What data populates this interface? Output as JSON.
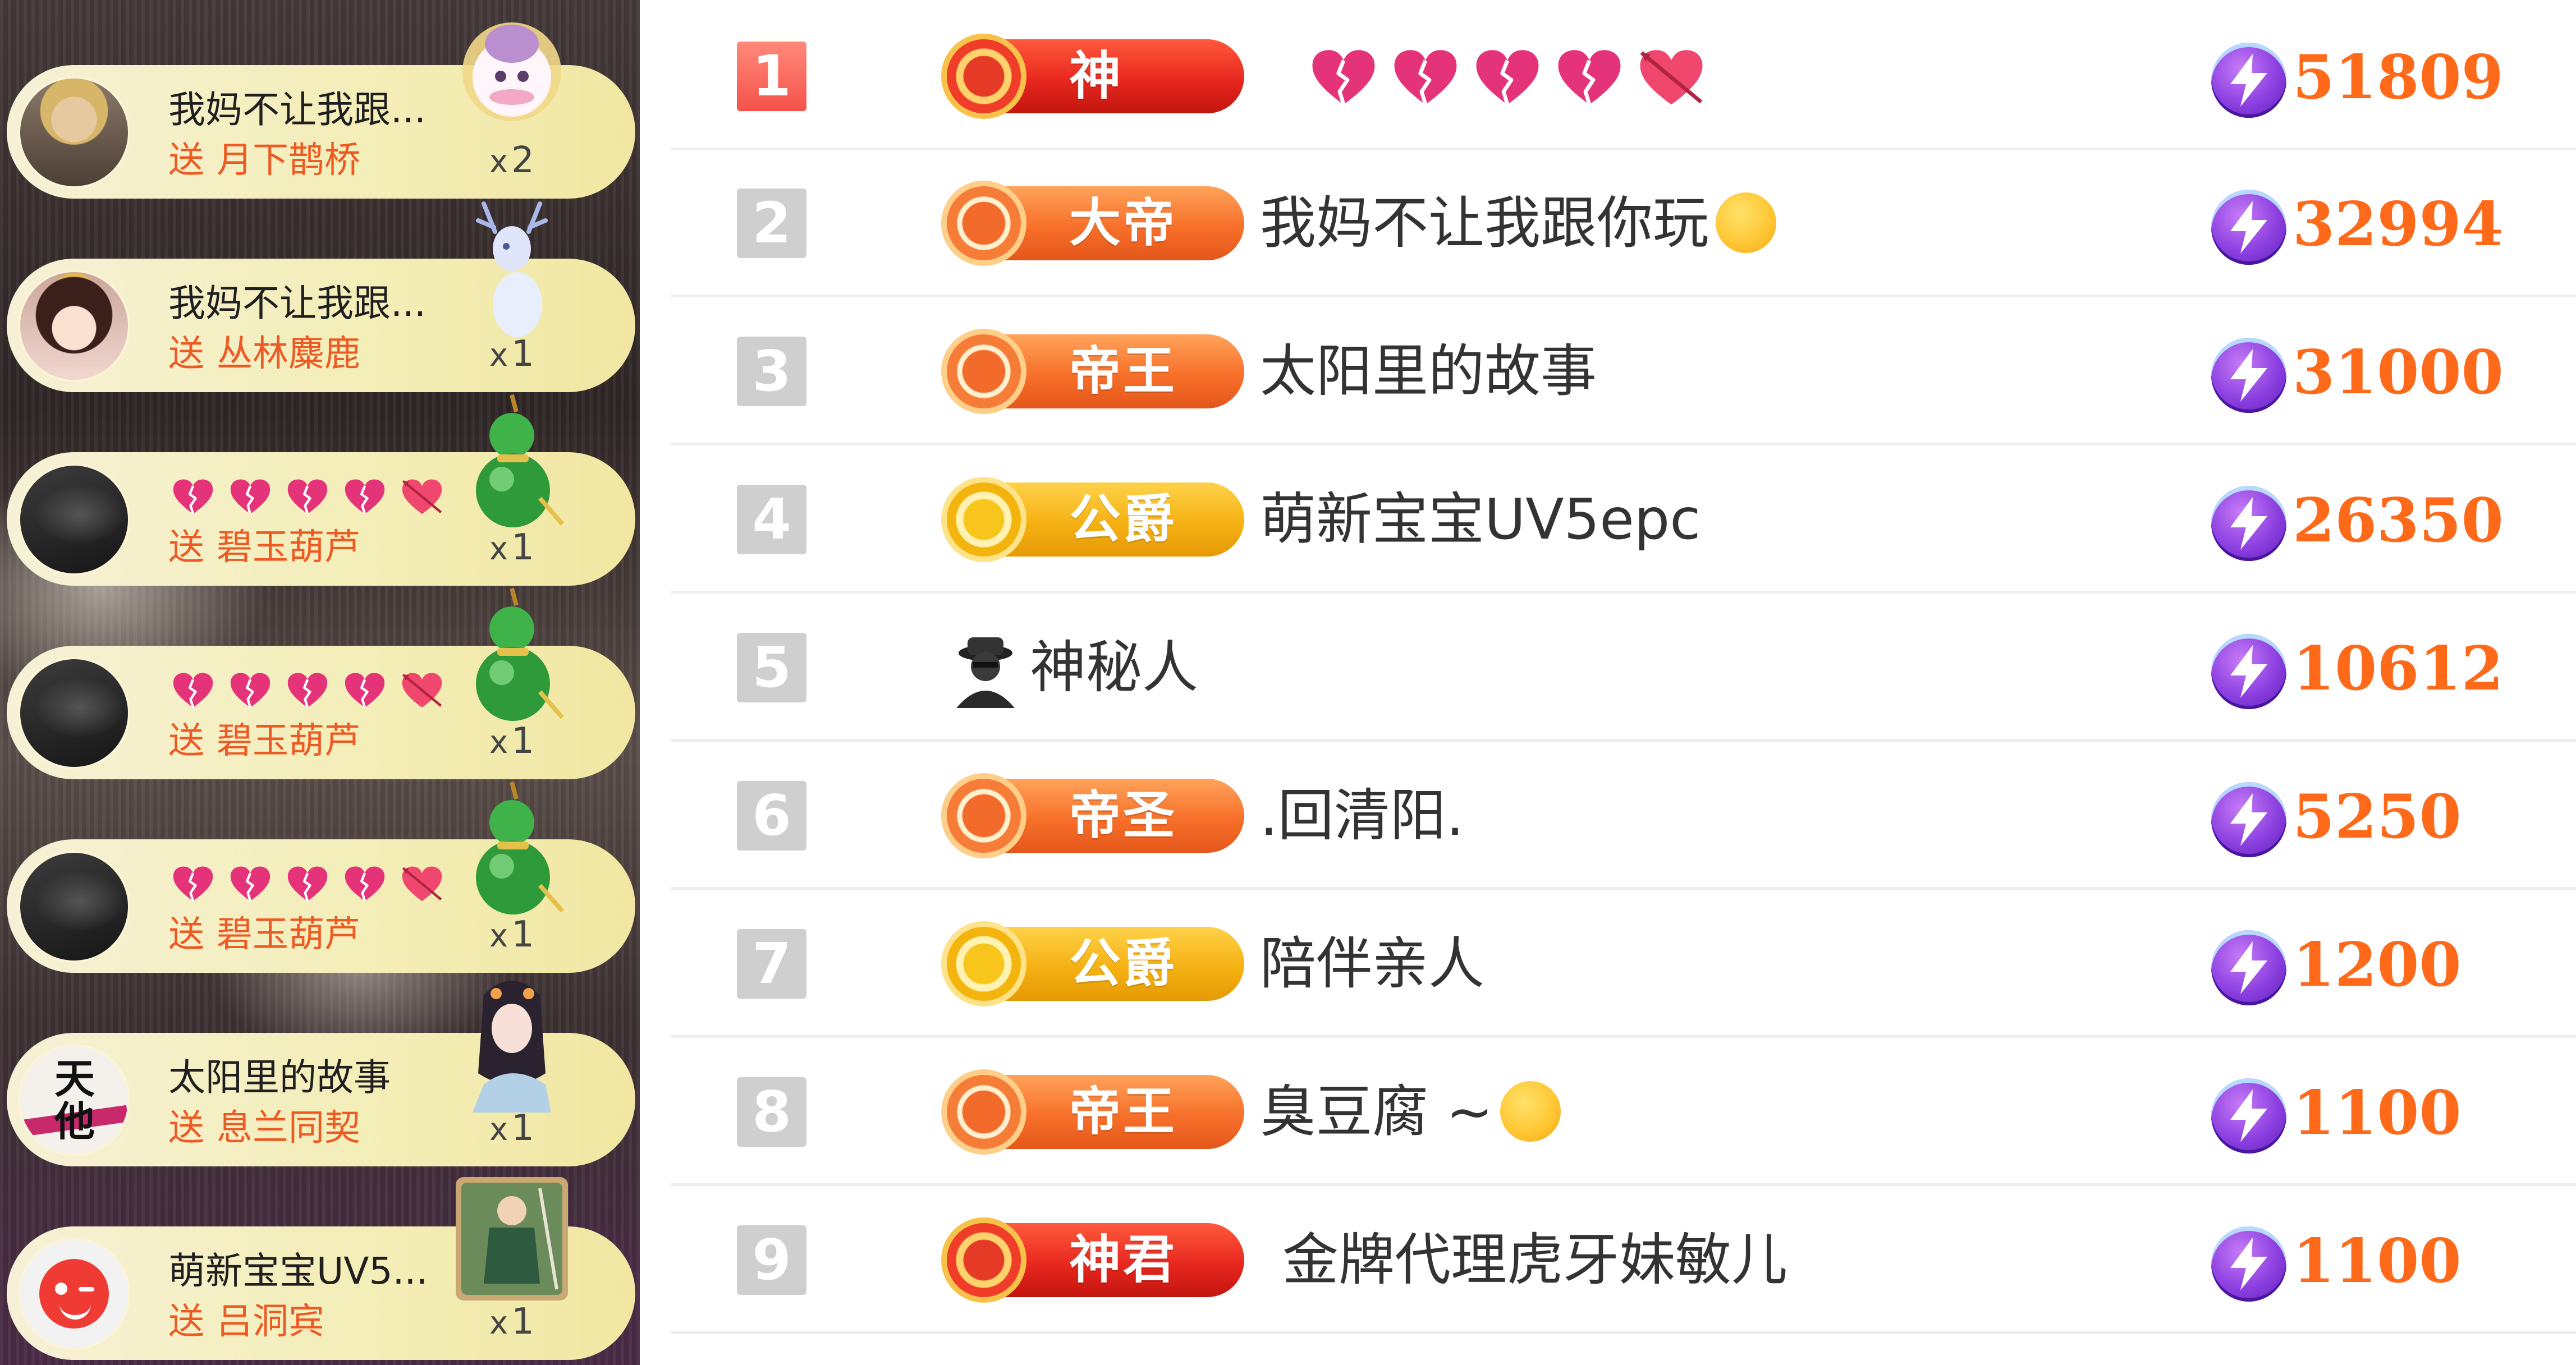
{
  "gift_feed": [
    {
      "sender": "我妈不让我跟...",
      "verb": "送",
      "gift": "月下鹊桥",
      "count_prefix": "x",
      "count": "2",
      "avatar": "avatar-photo-1",
      "gift_icon": "moon-rabbit-icon"
    },
    {
      "sender": "我妈不让我跟...",
      "verb": "送",
      "gift": "丛林麋鹿",
      "count_prefix": "x",
      "count": "1",
      "avatar": "avatar-girl",
      "gift_icon": "deer-icon"
    },
    {
      "sender": "",
      "sender_hearts": 5,
      "verb": "送",
      "gift": "碧玉葫芦",
      "count_prefix": "x",
      "count": "1",
      "avatar": "avatar-dark",
      "gift_icon": "gourd-icon"
    },
    {
      "sender": "",
      "sender_hearts": 5,
      "verb": "送",
      "gift": "碧玉葫芦",
      "count_prefix": "x",
      "count": "1",
      "avatar": "avatar-dark",
      "gift_icon": "gourd-icon"
    },
    {
      "sender": "",
      "sender_hearts": 5,
      "verb": "送",
      "gift": "碧玉葫芦",
      "count_prefix": "x",
      "count": "1",
      "avatar": "avatar-dark",
      "gift_icon": "gourd-icon"
    },
    {
      "sender": "太阳里的故事",
      "verb": "送",
      "gift": "息兰同契",
      "count_prefix": "x",
      "count": "1",
      "avatar": "avatar-calligraphy",
      "gift_icon": "fairy-icon",
      "avatar_text": "天他"
    },
    {
      "sender": "萌新宝宝UV5...",
      "verb": "送",
      "gift": "吕洞宾",
      "count_prefix": "x",
      "count": "1",
      "avatar": "avatar-red-wink",
      "gift_icon": "swordsman-icon"
    }
  ],
  "rank_list": [
    {
      "rank": "1",
      "badge": "神",
      "badge_style": "red",
      "name": "",
      "hearts": 5,
      "score": "51809"
    },
    {
      "rank": "2",
      "badge": "大帝",
      "badge_style": "orange",
      "name": "我妈不让我跟你玩",
      "emoji": "eye-roll-emoji",
      "score": "32994"
    },
    {
      "rank": "3",
      "badge": "帝王",
      "badge_style": "orange",
      "name": "太阳里的故事",
      "score": "31000"
    },
    {
      "rank": "4",
      "badge": "公爵",
      "badge_style": "gold",
      "name": "萌新宝宝UV5epc",
      "score": "26350"
    },
    {
      "rank": "5",
      "badge": "",
      "badge_style": "mystery",
      "name": "神秘人",
      "score": "10612"
    },
    {
      "rank": "6",
      "badge": "帝圣",
      "badge_style": "orange",
      "name": ".回清阳.",
      "score": "5250"
    },
    {
      "rank": "7",
      "badge": "公爵",
      "badge_style": "gold",
      "name": "陪伴亲人",
      "score": "1200"
    },
    {
      "rank": "8",
      "badge": "帝王",
      "badge_style": "orange",
      "name": "臭豆腐 ~",
      "emoji": "yum-emoji",
      "score": "1100"
    },
    {
      "rank": "9",
      "badge": "神君",
      "badge_style": "red",
      "name": "金牌代理虎牙妹敏儿",
      "score": "1100"
    }
  ],
  "colors": {
    "score": "#ff6a1a",
    "gift_name": "#ee5a24",
    "badge_red": "#e8281f",
    "badge_orange": "#f7702a",
    "badge_gold": "#f5b113",
    "rank_first": "#f5524a",
    "rank_default": "#cfcfcf",
    "heart": "#e5337a"
  }
}
